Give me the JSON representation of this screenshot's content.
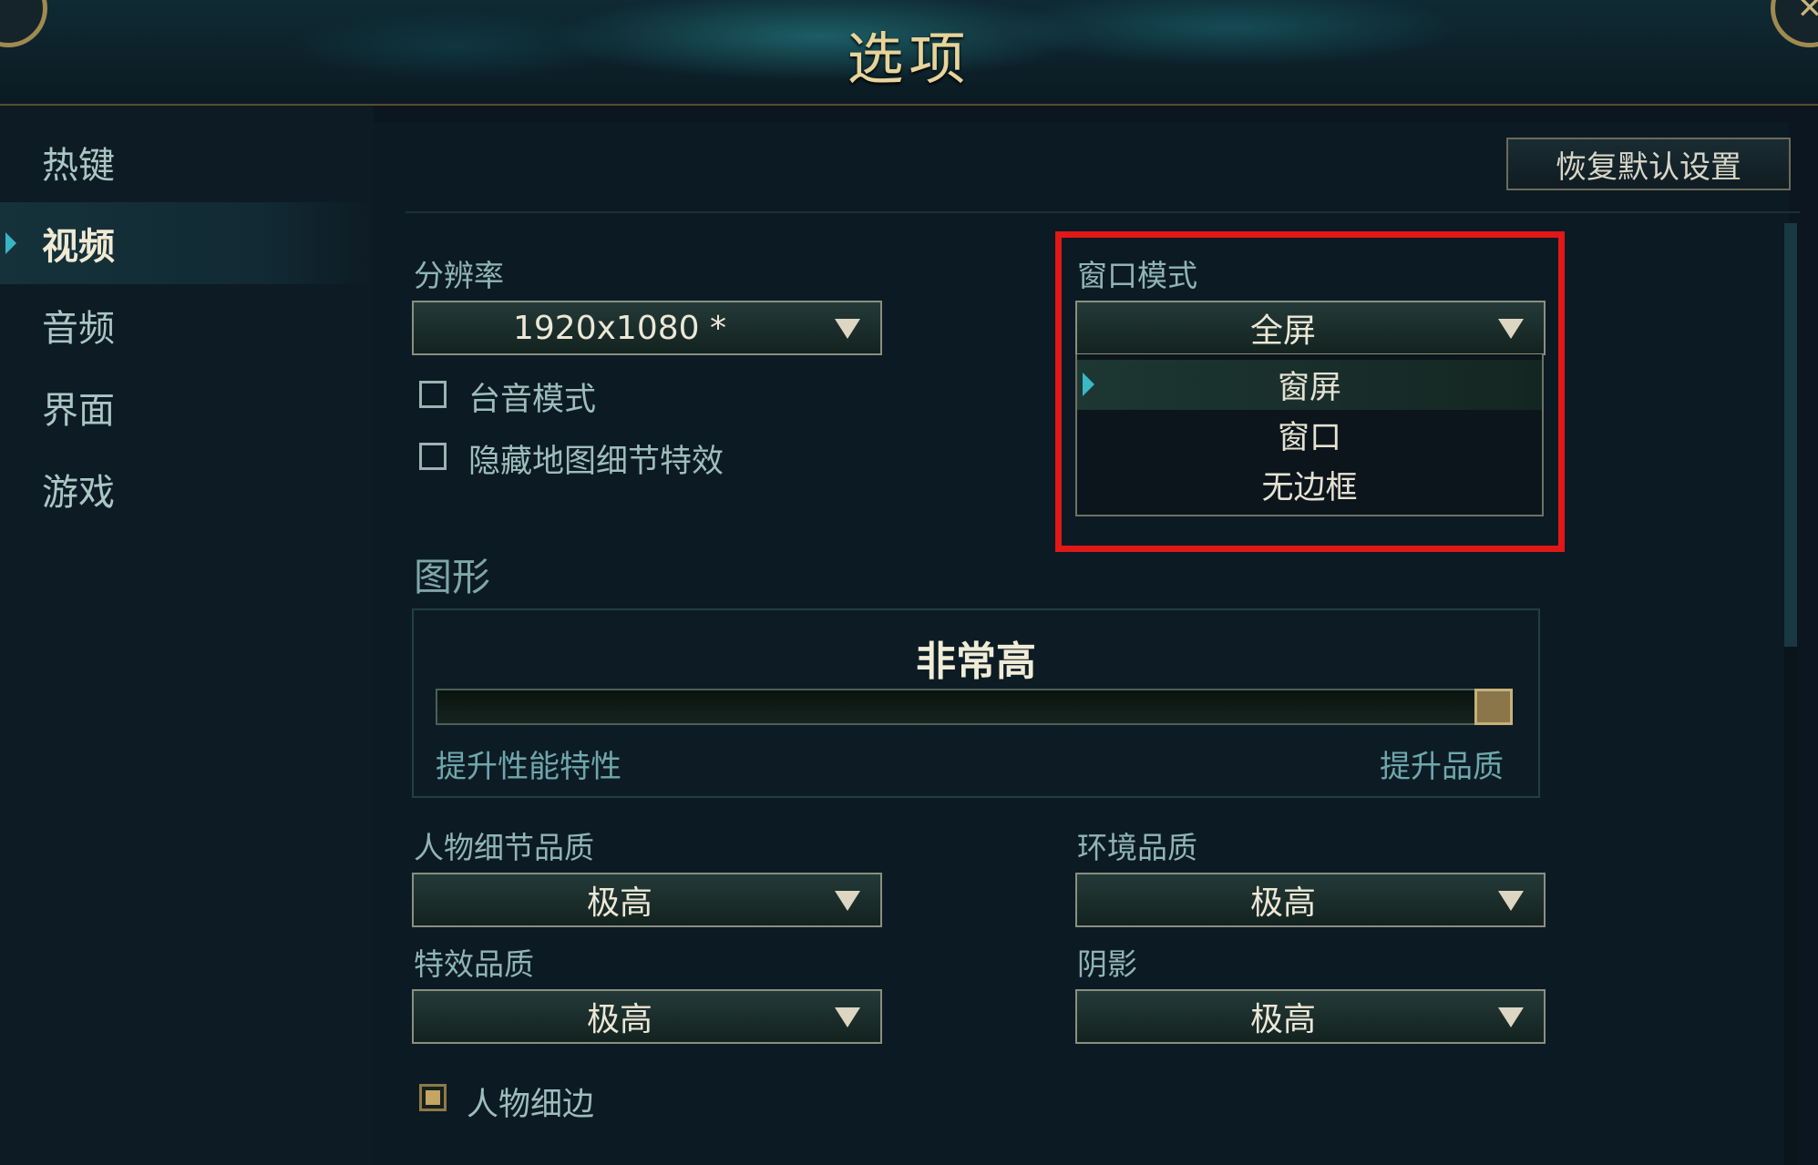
{
  "window": {
    "title": "选项"
  },
  "sidebar": {
    "items": [
      {
        "label": "热键"
      },
      {
        "label": "视频",
        "active": true
      },
      {
        "label": "音频"
      },
      {
        "label": "界面"
      },
      {
        "label": "游戏"
      }
    ]
  },
  "toolbar": {
    "reset_label": "恢复默认设置"
  },
  "resolution": {
    "label": "分辨率",
    "value": "1920x1080 *"
  },
  "checkboxes": [
    {
      "label": "台音模式",
      "checked": false
    },
    {
      "label": "隐藏地图细节特效",
      "checked": false
    }
  ],
  "window_mode": {
    "label": "窗口模式",
    "value": "全屏",
    "options": [
      "窗屏",
      "窗口",
      "无边框"
    ],
    "highlighted_option": "窗屏"
  },
  "graphics": {
    "section_title": "图形",
    "quality_value": "非常高",
    "slider_level": 1.0,
    "left_label": "提升性能特性",
    "right_label": "提升品质"
  },
  "quality_settings": {
    "character": {
      "label": "人物细节品质",
      "value": "极高"
    },
    "environment": {
      "label": "环境品质",
      "value": "极高"
    },
    "effects": {
      "label": "特效品质",
      "value": "极高"
    },
    "shadows": {
      "label": "阴影",
      "value": "极高"
    }
  },
  "character_outline": {
    "label": "人物细边",
    "checked": true
  },
  "colors": {
    "accent": "#38b6c4",
    "title_gold": "#e6d49a",
    "highlight_red": "#e01818",
    "background": "#0b1620"
  }
}
